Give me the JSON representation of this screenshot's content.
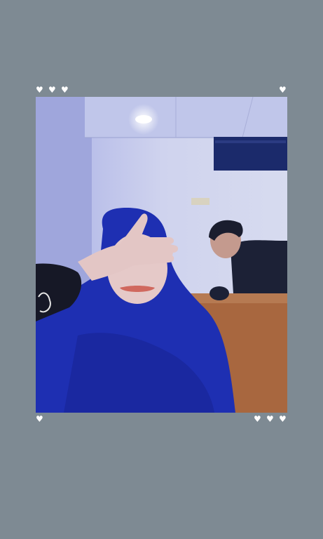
{
  "frame": {
    "background_color": "#7e8a93",
    "heart_color": "#ffffff",
    "heart_glyph": "♥",
    "top_left_hearts": 3,
    "top_right_hearts": 1,
    "bottom_left_hearts": 1,
    "bottom_right_hearts": 3
  },
  "photo": {
    "description_icon": "photo-image",
    "palette": {
      "wall": "#c6cbe9",
      "ceiling": "#b9bfe6",
      "hijab": "#1e2fb2",
      "sofa": "#a8673f",
      "ac_unit": "#1b2a6b",
      "skin": "#e5c9c8",
      "jacket": "#1c2136"
    }
  }
}
